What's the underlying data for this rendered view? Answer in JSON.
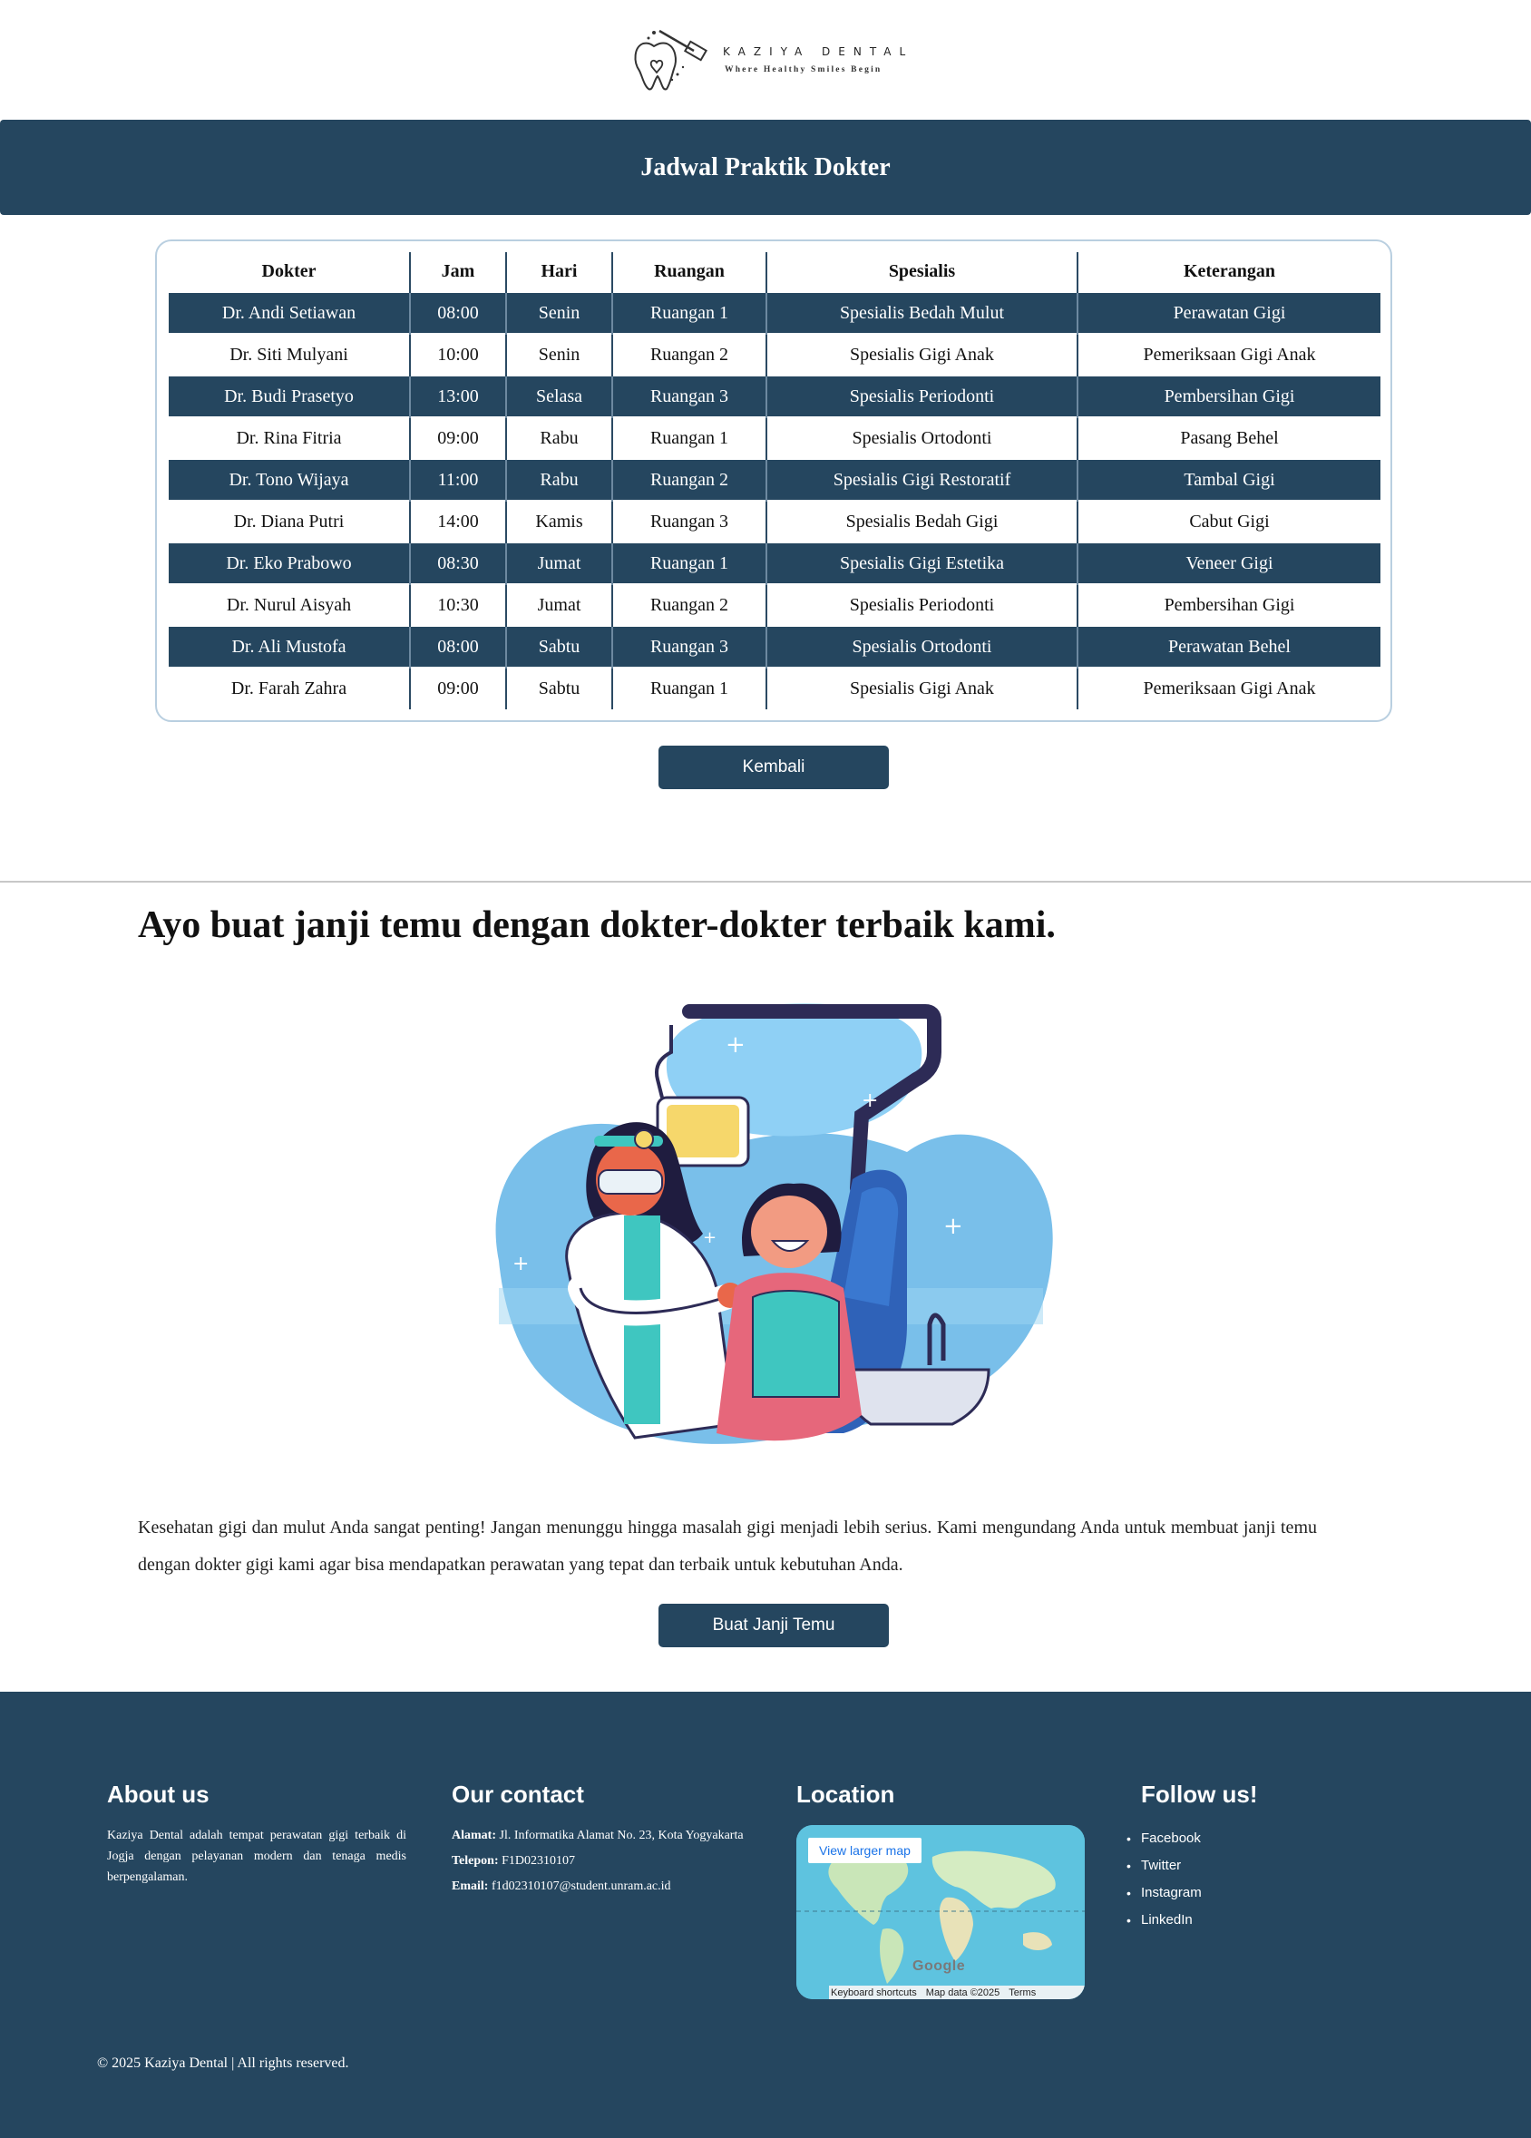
{
  "brand": {
    "name": "KAZIYA DENTAL",
    "tagline": "Where Healthy Smiles Begin"
  },
  "page_title": "Jadwal Praktik Dokter",
  "schedule": {
    "headers": [
      "Dokter",
      "Jam",
      "Hari",
      "Ruangan",
      "Spesialis",
      "Keterangan"
    ],
    "rows": [
      [
        "Dr. Andi Setiawan",
        "08:00",
        "Senin",
        "Ruangan 1",
        "Spesialis Bedah Mulut",
        "Perawatan Gigi"
      ],
      [
        "Dr. Siti Mulyani",
        "10:00",
        "Senin",
        "Ruangan 2",
        "Spesialis Gigi Anak",
        "Pemeriksaan Gigi Anak"
      ],
      [
        "Dr. Budi Prasetyo",
        "13:00",
        "Selasa",
        "Ruangan 3",
        "Spesialis Periodonti",
        "Pembersihan Gigi"
      ],
      [
        "Dr. Rina Fitria",
        "09:00",
        "Rabu",
        "Ruangan 1",
        "Spesialis Ortodonti",
        "Pasang Behel"
      ],
      [
        "Dr. Tono Wijaya",
        "11:00",
        "Rabu",
        "Ruangan 2",
        "Spesialis Gigi Restoratif",
        "Tambal Gigi"
      ],
      [
        "Dr. Diana Putri",
        "14:00",
        "Kamis",
        "Ruangan 3",
        "Spesialis Bedah Gigi",
        "Cabut Gigi"
      ],
      [
        "Dr. Eko Prabowo",
        "08:30",
        "Jumat",
        "Ruangan 1",
        "Spesialis Gigi Estetika",
        "Veneer Gigi"
      ],
      [
        "Dr. Nurul Aisyah",
        "10:30",
        "Jumat",
        "Ruangan 2",
        "Spesialis Periodonti",
        "Pembersihan Gigi"
      ],
      [
        "Dr. Ali Mustofa",
        "08:00",
        "Sabtu",
        "Ruangan 3",
        "Spesialis Ortodonti",
        "Perawatan Behel"
      ],
      [
        "Dr. Farah Zahra",
        "09:00",
        "Sabtu",
        "Ruangan 1",
        "Spesialis Gigi Anak",
        "Pemeriksaan Gigi Anak"
      ]
    ]
  },
  "buttons": {
    "back": "Kembali",
    "appointment": "Buat Janji Temu"
  },
  "cta": {
    "heading": "Ayo buat janji temu dengan dokter-dokter terbaik kami.",
    "body": "Kesehatan gigi dan mulut Anda sangat penting! Jangan menunggu hingga masalah gigi menjadi lebih serius. Kami mengundang Anda untuk membuat janji temu dengan dokter gigi kami agar bisa mendapatkan perawatan yang tepat dan terbaik untuk kebutuhan Anda."
  },
  "footer": {
    "about": {
      "title": "About us",
      "text": "Kaziya Dental adalah tempat perawatan gigi terbaik di Jogja dengan pelayanan modern dan tenaga medis berpengalaman."
    },
    "contact": {
      "title": "Our contact",
      "address_label": "Alamat:",
      "address": "Jl. Informatika Alamat No. 23, Kota Yogyakarta",
      "phone_label": "Telepon:",
      "phone": "F1D02310107",
      "email_label": "Email:",
      "email": "f1d02310107@student.unram.ac.id"
    },
    "location": {
      "title": "Location",
      "map_link": "View larger map",
      "map_logo": "Google",
      "map_shortcuts": "Keyboard shortcuts",
      "map_data": "Map data ©2025",
      "map_terms": "Terms"
    },
    "follow": {
      "title": "Follow us!",
      "links": [
        "Facebook",
        "Twitter",
        "Instagram",
        "LinkedIn"
      ]
    },
    "copyright": "© 2025 Kaziya Dental | All rights reserved."
  },
  "colors": {
    "primary": "#25465f",
    "table_border": "#b9cfe0",
    "illustration_sky": "#79bfea",
    "illustration_teal": "#3fc6c0"
  }
}
